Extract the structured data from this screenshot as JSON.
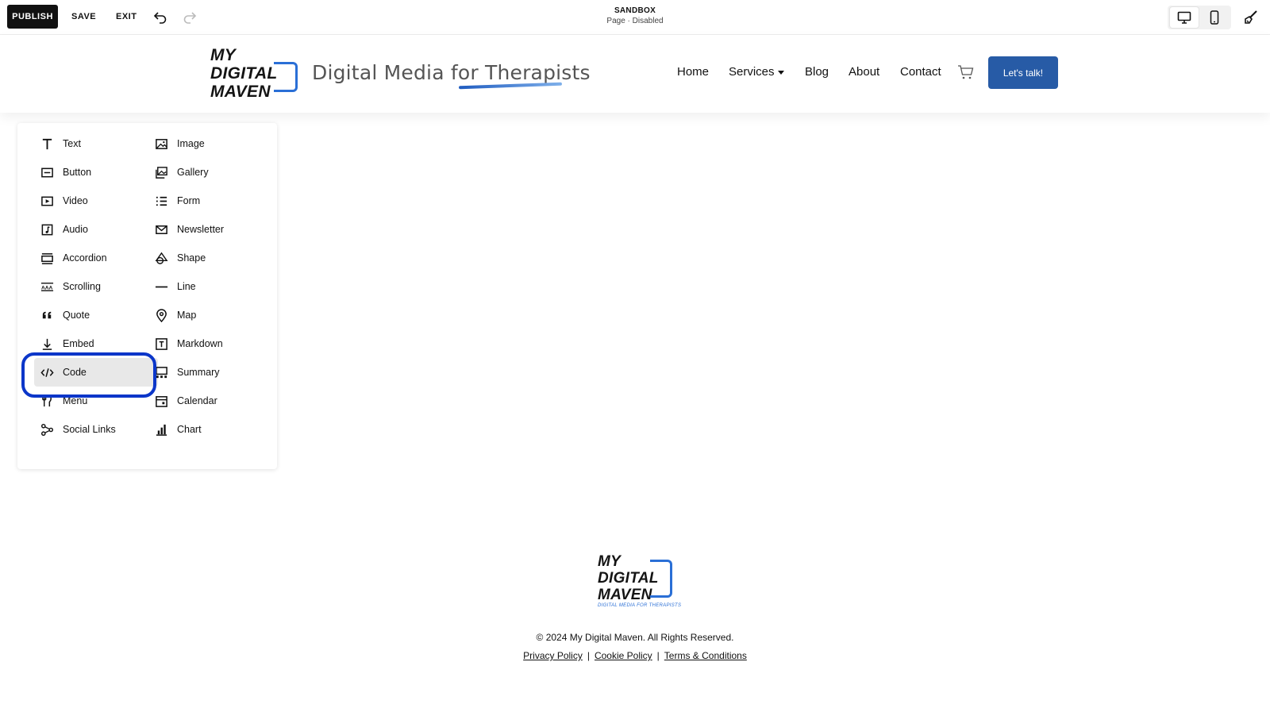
{
  "editor": {
    "publish_label": "PUBLISH",
    "save_label": "SAVE",
    "exit_label": "EXIT",
    "site_name": "SANDBOX",
    "page_state": "Page · Disabled",
    "icons": [
      "undo-icon",
      "redo-icon",
      "desktop-icon",
      "mobile-icon",
      "paint-brush-icon"
    ]
  },
  "site": {
    "logo_lines": [
      "MY",
      "DIGITAL",
      "MAVEN"
    ],
    "tagline": "Digital Media for Therapists",
    "nav": {
      "home": "Home",
      "services": "Services",
      "blog": "Blog",
      "about": "About",
      "contact": "Contact"
    },
    "cta_label": "Let's talk!",
    "brand_color": "#275ba6"
  },
  "blocks": {
    "left": [
      {
        "label": "Text",
        "icon": "text-icon"
      },
      {
        "label": "Button",
        "icon": "button-icon"
      },
      {
        "label": "Video",
        "icon": "video-icon"
      },
      {
        "label": "Audio",
        "icon": "audio-icon"
      },
      {
        "label": "Accordion",
        "icon": "accordion-icon"
      },
      {
        "label": "Scrolling",
        "icon": "scrolling-icon"
      },
      {
        "label": "Quote",
        "icon": "quote-icon"
      },
      {
        "label": "Embed",
        "icon": "embed-icon"
      },
      {
        "label": "Code",
        "icon": "code-icon",
        "selected": true
      },
      {
        "label": "Menu",
        "icon": "menu-icon"
      },
      {
        "label": "Social Links",
        "icon": "social-links-icon"
      }
    ],
    "right": [
      {
        "label": "Image",
        "icon": "image-icon"
      },
      {
        "label": "Gallery",
        "icon": "gallery-icon"
      },
      {
        "label": "Form",
        "icon": "form-icon"
      },
      {
        "label": "Newsletter",
        "icon": "newsletter-icon"
      },
      {
        "label": "Shape",
        "icon": "shape-icon"
      },
      {
        "label": "Line",
        "icon": "line-icon"
      },
      {
        "label": "Map",
        "icon": "map-icon"
      },
      {
        "label": "Markdown",
        "icon": "markdown-icon"
      },
      {
        "label": "Summary",
        "icon": "summary-icon"
      },
      {
        "label": "Calendar",
        "icon": "calendar-icon"
      },
      {
        "label": "Chart",
        "icon": "chart-icon"
      }
    ]
  },
  "footer": {
    "logo_lines": [
      "MY",
      "DIGITAL",
      "MAVEN"
    ],
    "logo_sub": "DIGITAL MEDIA FOR THERAPISTS",
    "copyright": "© 2024 My Digital Maven. All Rights Reserved.",
    "links": {
      "privacy": "Privacy Policy",
      "cookie": "Cookie Policy",
      "terms": "Terms & Conditions"
    },
    "separator": "|"
  }
}
